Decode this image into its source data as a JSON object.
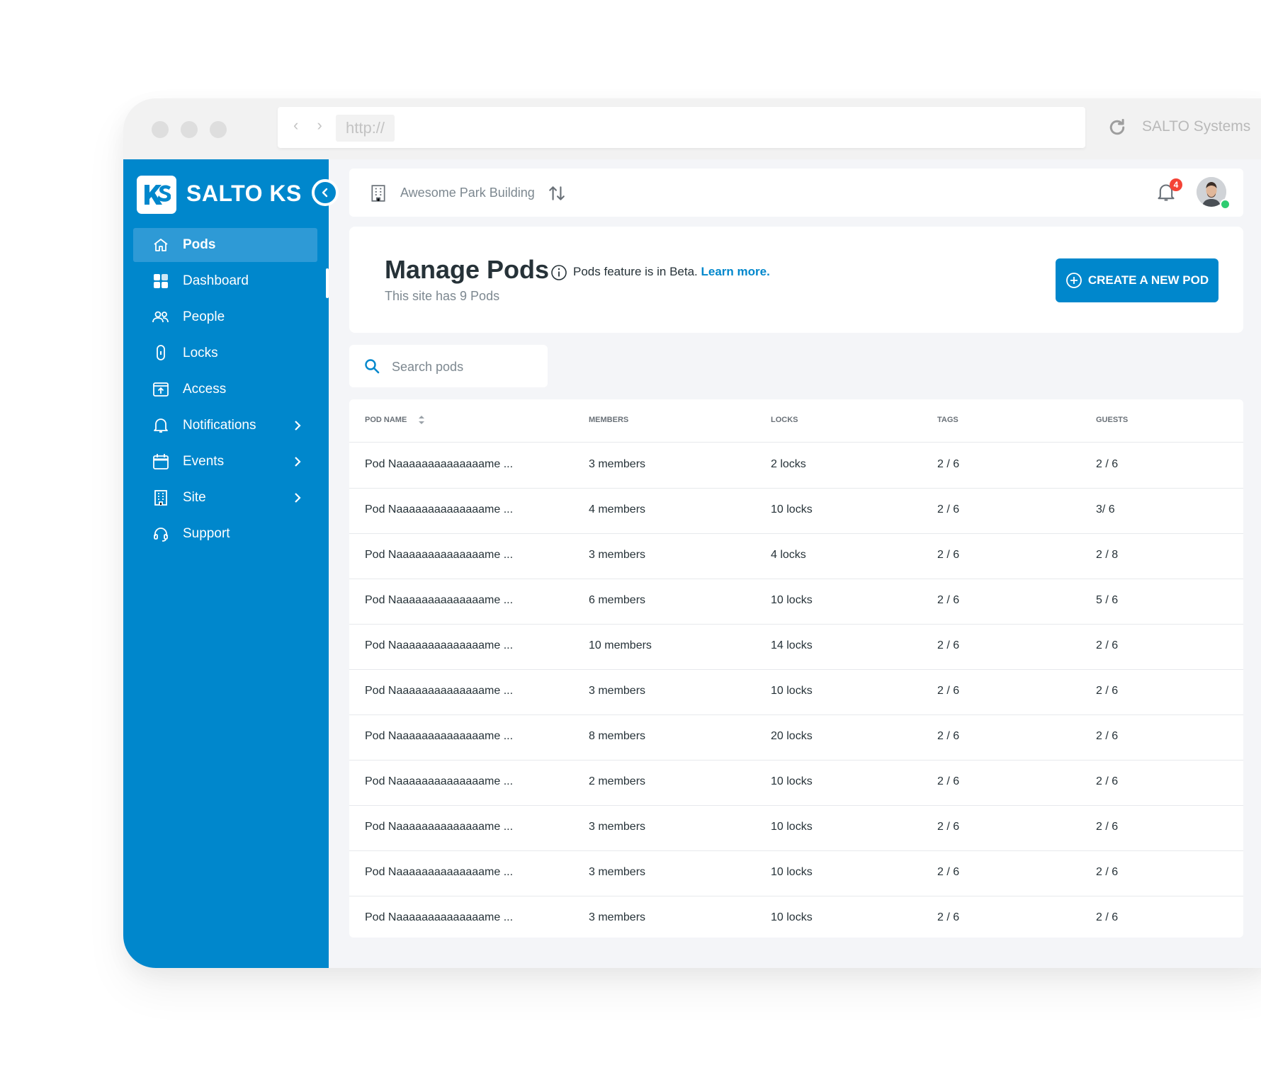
{
  "browser": {
    "url": "http://",
    "brand": "SALTO Systems"
  },
  "sidebar": {
    "logo_text": "SALTO KS",
    "items": [
      {
        "label": "Pods",
        "icon": "home-icon",
        "active": true
      },
      {
        "label": "Dashboard",
        "icon": "grid-icon"
      },
      {
        "label": "People",
        "icon": "people-icon"
      },
      {
        "label": "Locks",
        "icon": "lock-icon"
      },
      {
        "label": "Access",
        "icon": "access-icon"
      },
      {
        "label": "Notifications",
        "icon": "bell-icon",
        "has_submenu": true
      },
      {
        "label": "Events",
        "icon": "calendar-icon",
        "has_submenu": true
      },
      {
        "label": "Site",
        "icon": "building-icon",
        "has_submenu": true
      },
      {
        "label": "Support",
        "icon": "headset-icon"
      }
    ]
  },
  "topbar": {
    "building_name": "Awesome Park Building",
    "notification_count": "4"
  },
  "header": {
    "title": "Manage Pods",
    "beta_text": "Pods feature is in Beta.",
    "beta_link": "Learn more.",
    "subtitle": "This site has 9 Pods",
    "create_button": "CREATE A NEW POD"
  },
  "search": {
    "placeholder": "Search pods"
  },
  "table": {
    "columns": [
      "POD NAME",
      "MEMBERS",
      "LOCKS",
      "TAGS",
      "GUESTS"
    ],
    "rows": [
      {
        "name": "Pod Naaaaaaaaaaaaaame ...",
        "members": "3 members",
        "locks": "2 locks",
        "tags": "2 / 6",
        "guests": "2 / 6"
      },
      {
        "name": "Pod Naaaaaaaaaaaaaame ...",
        "members": "4 members",
        "locks": "10 locks",
        "tags": "2 / 6",
        "guests": "3/ 6"
      },
      {
        "name": "Pod Naaaaaaaaaaaaaame ...",
        "members": "3 members",
        "locks": "4 locks",
        "tags": "2 / 6",
        "guests": "2 / 8"
      },
      {
        "name": "Pod Naaaaaaaaaaaaaame ...",
        "members": "6 members",
        "locks": "10 locks",
        "tags": "2 / 6",
        "guests": "5 / 6"
      },
      {
        "name": "Pod Naaaaaaaaaaaaaame ...",
        "members": "10 members",
        "locks": "14 locks",
        "tags": "2 / 6",
        "guests": "2 / 6"
      },
      {
        "name": "Pod Naaaaaaaaaaaaaame ...",
        "members": "3 members",
        "locks": "10 locks",
        "tags": "2 / 6",
        "guests": "2 / 6"
      },
      {
        "name": "Pod Naaaaaaaaaaaaaame ...",
        "members": "8 members",
        "locks": "20 locks",
        "tags": "2 / 6",
        "guests": "2 / 6"
      },
      {
        "name": "Pod Naaaaaaaaaaaaaame ...",
        "members": "2 members",
        "locks": "10 locks",
        "tags": "2 / 6",
        "guests": "2 / 6"
      },
      {
        "name": "Pod Naaaaaaaaaaaaaame ...",
        "members": "3 members",
        "locks": "10 locks",
        "tags": "2 / 6",
        "guests": "2 / 6"
      },
      {
        "name": "Pod Naaaaaaaaaaaaaame ...",
        "members": "3 members",
        "locks": "10 locks",
        "tags": "2 / 6",
        "guests": "2 / 6"
      },
      {
        "name": "Pod Naaaaaaaaaaaaaame ...",
        "members": "3 members",
        "locks": "10 locks",
        "tags": "2 / 6",
        "guests": "2 / 6"
      }
    ]
  },
  "colors": {
    "brand_blue": "#0087cc",
    "sidebar_active": "#2e9ad6",
    "badge_red": "#f44336",
    "online_green": "#2ecc71"
  }
}
